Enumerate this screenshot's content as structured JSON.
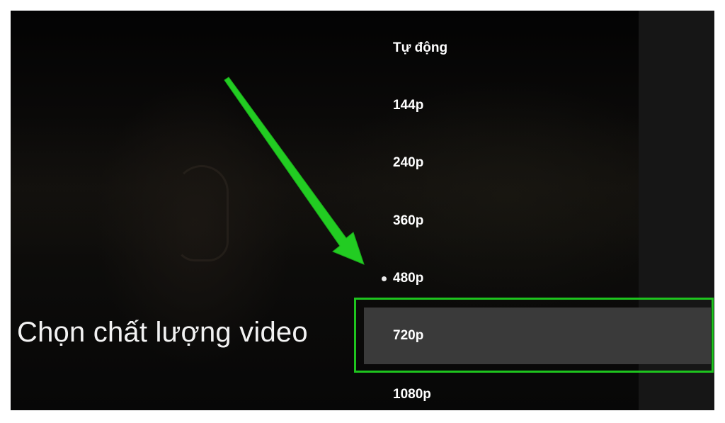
{
  "caption": "Chọn chất lượng video",
  "quality_menu": {
    "items": [
      {
        "label": "Tự động"
      },
      {
        "label": "144p"
      },
      {
        "label": "240p"
      },
      {
        "label": "360p"
      },
      {
        "label": "480p"
      },
      {
        "label": "720p"
      },
      {
        "label": "1080p"
      }
    ],
    "selected": "480p",
    "focused": "720p"
  },
  "colors": {
    "annotation_green": "#22cc22",
    "highlight": "#3a3a3a",
    "text": "#ffffff"
  },
  "annotations": {
    "arrow_icon": "green-arrow-icon",
    "highlight_box": "green-highlight-box"
  }
}
